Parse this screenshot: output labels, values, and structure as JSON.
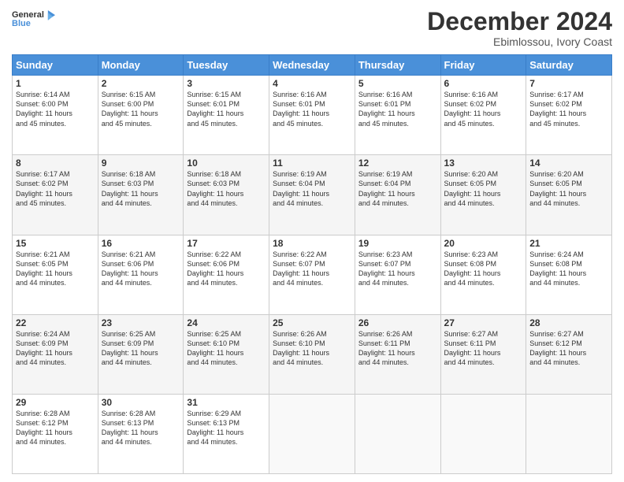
{
  "header": {
    "logo_line1": "General",
    "logo_line2": "Blue",
    "month": "December 2024",
    "location": "Ebimlossou, Ivory Coast"
  },
  "days_of_week": [
    "Sunday",
    "Monday",
    "Tuesday",
    "Wednesday",
    "Thursday",
    "Friday",
    "Saturday"
  ],
  "weeks": [
    [
      {
        "day": "1",
        "info": "Sunrise: 6:14 AM\nSunset: 6:00 PM\nDaylight: 11 hours\nand 45 minutes."
      },
      {
        "day": "2",
        "info": "Sunrise: 6:15 AM\nSunset: 6:00 PM\nDaylight: 11 hours\nand 45 minutes."
      },
      {
        "day": "3",
        "info": "Sunrise: 6:15 AM\nSunset: 6:01 PM\nDaylight: 11 hours\nand 45 minutes."
      },
      {
        "day": "4",
        "info": "Sunrise: 6:16 AM\nSunset: 6:01 PM\nDaylight: 11 hours\nand 45 minutes."
      },
      {
        "day": "5",
        "info": "Sunrise: 6:16 AM\nSunset: 6:01 PM\nDaylight: 11 hours\nand 45 minutes."
      },
      {
        "day": "6",
        "info": "Sunrise: 6:16 AM\nSunset: 6:02 PM\nDaylight: 11 hours\nand 45 minutes."
      },
      {
        "day": "7",
        "info": "Sunrise: 6:17 AM\nSunset: 6:02 PM\nDaylight: 11 hours\nand 45 minutes."
      }
    ],
    [
      {
        "day": "8",
        "info": "Sunrise: 6:17 AM\nSunset: 6:02 PM\nDaylight: 11 hours\nand 45 minutes."
      },
      {
        "day": "9",
        "info": "Sunrise: 6:18 AM\nSunset: 6:03 PM\nDaylight: 11 hours\nand 44 minutes."
      },
      {
        "day": "10",
        "info": "Sunrise: 6:18 AM\nSunset: 6:03 PM\nDaylight: 11 hours\nand 44 minutes."
      },
      {
        "day": "11",
        "info": "Sunrise: 6:19 AM\nSunset: 6:04 PM\nDaylight: 11 hours\nand 44 minutes."
      },
      {
        "day": "12",
        "info": "Sunrise: 6:19 AM\nSunset: 6:04 PM\nDaylight: 11 hours\nand 44 minutes."
      },
      {
        "day": "13",
        "info": "Sunrise: 6:20 AM\nSunset: 6:05 PM\nDaylight: 11 hours\nand 44 minutes."
      },
      {
        "day": "14",
        "info": "Sunrise: 6:20 AM\nSunset: 6:05 PM\nDaylight: 11 hours\nand 44 minutes."
      }
    ],
    [
      {
        "day": "15",
        "info": "Sunrise: 6:21 AM\nSunset: 6:05 PM\nDaylight: 11 hours\nand 44 minutes."
      },
      {
        "day": "16",
        "info": "Sunrise: 6:21 AM\nSunset: 6:06 PM\nDaylight: 11 hours\nand 44 minutes."
      },
      {
        "day": "17",
        "info": "Sunrise: 6:22 AM\nSunset: 6:06 PM\nDaylight: 11 hours\nand 44 minutes."
      },
      {
        "day": "18",
        "info": "Sunrise: 6:22 AM\nSunset: 6:07 PM\nDaylight: 11 hours\nand 44 minutes."
      },
      {
        "day": "19",
        "info": "Sunrise: 6:23 AM\nSunset: 6:07 PM\nDaylight: 11 hours\nand 44 minutes."
      },
      {
        "day": "20",
        "info": "Sunrise: 6:23 AM\nSunset: 6:08 PM\nDaylight: 11 hours\nand 44 minutes."
      },
      {
        "day": "21",
        "info": "Sunrise: 6:24 AM\nSunset: 6:08 PM\nDaylight: 11 hours\nand 44 minutes."
      }
    ],
    [
      {
        "day": "22",
        "info": "Sunrise: 6:24 AM\nSunset: 6:09 PM\nDaylight: 11 hours\nand 44 minutes."
      },
      {
        "day": "23",
        "info": "Sunrise: 6:25 AM\nSunset: 6:09 PM\nDaylight: 11 hours\nand 44 minutes."
      },
      {
        "day": "24",
        "info": "Sunrise: 6:25 AM\nSunset: 6:10 PM\nDaylight: 11 hours\nand 44 minutes."
      },
      {
        "day": "25",
        "info": "Sunrise: 6:26 AM\nSunset: 6:10 PM\nDaylight: 11 hours\nand 44 minutes."
      },
      {
        "day": "26",
        "info": "Sunrise: 6:26 AM\nSunset: 6:11 PM\nDaylight: 11 hours\nand 44 minutes."
      },
      {
        "day": "27",
        "info": "Sunrise: 6:27 AM\nSunset: 6:11 PM\nDaylight: 11 hours\nand 44 minutes."
      },
      {
        "day": "28",
        "info": "Sunrise: 6:27 AM\nSunset: 6:12 PM\nDaylight: 11 hours\nand 44 minutes."
      }
    ],
    [
      {
        "day": "29",
        "info": "Sunrise: 6:28 AM\nSunset: 6:12 PM\nDaylight: 11 hours\nand 44 minutes."
      },
      {
        "day": "30",
        "info": "Sunrise: 6:28 AM\nSunset: 6:13 PM\nDaylight: 11 hours\nand 44 minutes."
      },
      {
        "day": "31",
        "info": "Sunrise: 6:29 AM\nSunset: 6:13 PM\nDaylight: 11 hours\nand 44 minutes."
      },
      {
        "day": "",
        "info": ""
      },
      {
        "day": "",
        "info": ""
      },
      {
        "day": "",
        "info": ""
      },
      {
        "day": "",
        "info": ""
      }
    ]
  ]
}
